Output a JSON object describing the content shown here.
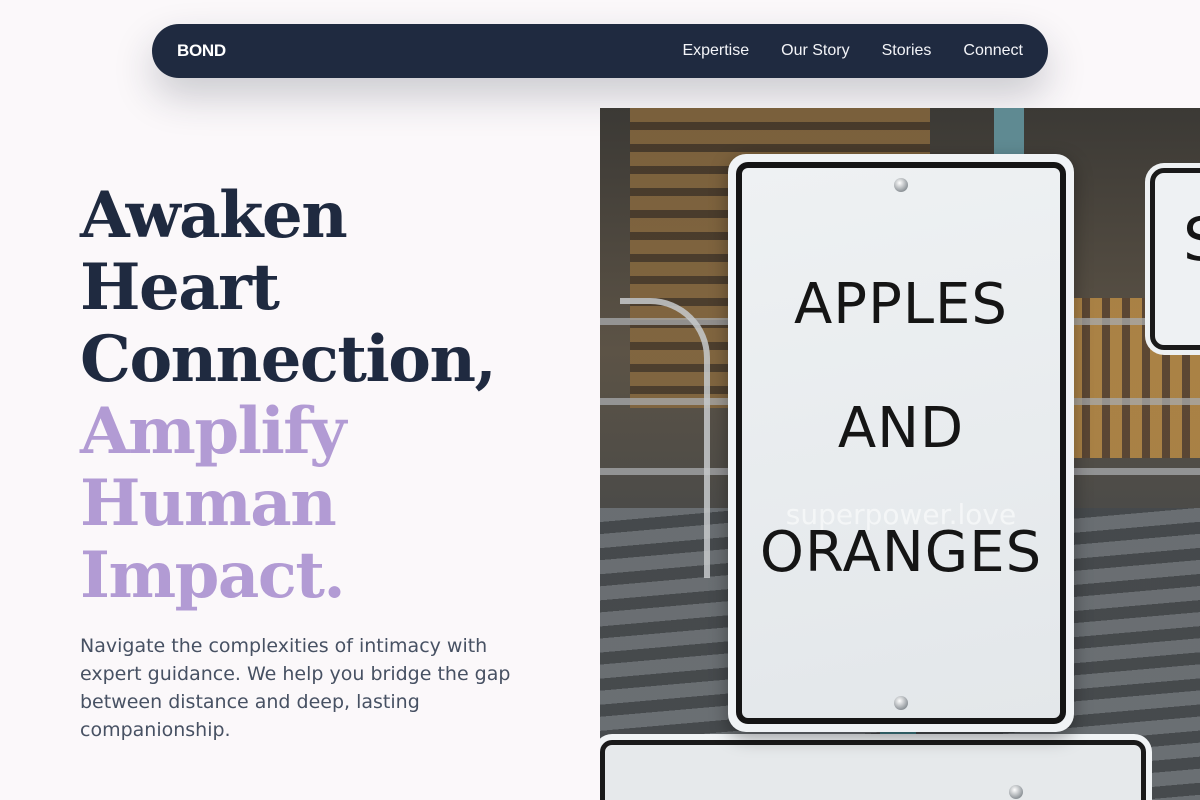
{
  "nav": {
    "brand": "BOND",
    "links": [
      "Expertise",
      "Our Story",
      "Stories",
      "Connect"
    ]
  },
  "hero": {
    "title_dark": [
      "Awaken",
      "Heart",
      "Connection,"
    ],
    "title_accent": [
      "Amplify",
      "Human",
      "Impact."
    ],
    "subtitle": "Navigate the complexities of intimacy with expert guidance. We help you bridge the gap between distance and deep, lasting companionship."
  },
  "image": {
    "sign_lines": [
      "APPLES",
      "AND",
      "ORANGES"
    ],
    "watermark": "superpower.love",
    "side_sign_letter": "S"
  },
  "colors": {
    "nav_bg": "#1f2a40",
    "page_bg": "#fbf8fa",
    "title_dark": "#1f2a40",
    "title_accent": "#b29bd4",
    "body_text": "#475163"
  }
}
